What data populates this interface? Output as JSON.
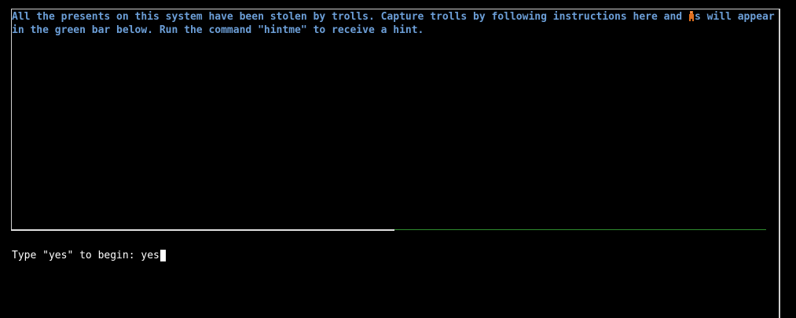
{
  "colors": {
    "background": "#000000",
    "instruction_text": "#6c9fd8",
    "prompt_text": "#ffffff",
    "frame": "#cfcfcf",
    "trollbar_track": "#e0e0e0",
    "trollbar_green": "#2e8b2e",
    "troll_icon": "#e07020"
  },
  "instructions": {
    "text_before_icon": "All the presents on this system have been stolen by trolls. Capture trolls by following instructions here and ",
    "icon": "troll-icon",
    "text_after_icon": "s will appear in the green bar below. Run the command \"hintme\" to receive a hint."
  },
  "prompt": {
    "label": "Type \"yes\" to begin: ",
    "input_value": "yes"
  }
}
